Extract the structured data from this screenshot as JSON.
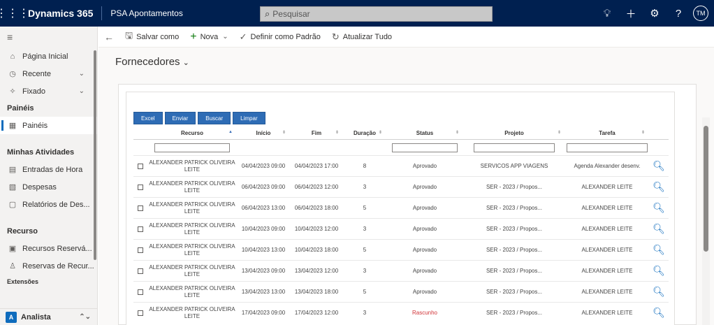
{
  "topbar": {
    "brand": "Dynamics 365",
    "app_name": "PSA Apontamentos",
    "search_placeholder": "Pesquisar",
    "avatar_initials": "TM",
    "icons": [
      "lightbulb-icon",
      "plus-icon",
      "settings-icon",
      "help-icon"
    ]
  },
  "sidebar": {
    "items": [
      {
        "label": "Página Inicial",
        "icon": "home-icon"
      },
      {
        "label": "Recente",
        "icon": "clock-icon"
      },
      {
        "label": "Fixado",
        "icon": "pin-icon"
      }
    ],
    "section_paineis": "Painéis",
    "paineis_item": "Painéis",
    "section_atividades": "Minhas Atividades",
    "atividades": [
      "Entradas de Hora",
      "Despesas",
      "Relatórios de Des..."
    ],
    "section_recurso": "Recurso",
    "recurso": [
      "Recursos Reservá...",
      "Reservas de Recur..."
    ],
    "section_extensoes": "Extensões",
    "area_badge": "A",
    "area_name": "Analista"
  },
  "commandbar": {
    "salvar_como": "Salvar como",
    "nova": "Nova",
    "definir_padrao": "Definir como Padrão",
    "atualizar_tudo": "Atualizar Tudo"
  },
  "page": {
    "title": "Fornecedores"
  },
  "actions": {
    "excel": "Excel",
    "enviar": "Enviar",
    "buscar": "Buscar",
    "limpar": "Limpar"
  },
  "grid": {
    "headers": {
      "recurso": "Recurso",
      "inicio": "Início",
      "fim": "Fim",
      "duracao": "Duração",
      "status": "Status",
      "projeto": "Projeto",
      "tarefa": "Tarefa"
    },
    "rows": [
      {
        "recurso_1": "ALEXANDER PATRICK OLIVEIRA",
        "recurso_2": "LEITE",
        "inicio": "04/04/2023 09:00",
        "fim": "04/04/2023 17:00",
        "duracao": "8",
        "status": "Aprovado",
        "projeto": "SERVICOS APP VIAGENS",
        "tarefa": "Agenda Alexander desenv."
      },
      {
        "recurso_1": "ALEXANDER PATRICK OLIVEIRA",
        "recurso_2": "LEITE",
        "inicio": "06/04/2023 09:00",
        "fim": "06/04/2023 12:00",
        "duracao": "3",
        "status": "Aprovado",
        "projeto": "SER - 2023 / Propos...",
        "tarefa": "ALEXANDER LEITE"
      },
      {
        "recurso_1": "ALEXANDER PATRICK OLIVEIRA",
        "recurso_2": "LEITE",
        "inicio": "06/04/2023 13:00",
        "fim": "06/04/2023 18:00",
        "duracao": "5",
        "status": "Aprovado",
        "projeto": "SER - 2023 / Propos...",
        "tarefa": "ALEXANDER LEITE"
      },
      {
        "recurso_1": "ALEXANDER PATRICK OLIVEIRA",
        "recurso_2": "LEITE",
        "inicio": "10/04/2023 09:00",
        "fim": "10/04/2023 12:00",
        "duracao": "3",
        "status": "Aprovado",
        "projeto": "SER - 2023 / Propos...",
        "tarefa": "ALEXANDER LEITE"
      },
      {
        "recurso_1": "ALEXANDER PATRICK OLIVEIRA",
        "recurso_2": "LEITE",
        "inicio": "10/04/2023 13:00",
        "fim": "10/04/2023 18:00",
        "duracao": "5",
        "status": "Aprovado",
        "projeto": "SER - 2023 / Propos...",
        "tarefa": "ALEXANDER LEITE"
      },
      {
        "recurso_1": "ALEXANDER PATRICK OLIVEIRA",
        "recurso_2": "LEITE",
        "inicio": "13/04/2023 09:00",
        "fim": "13/04/2023 12:00",
        "duracao": "3",
        "status": "Aprovado",
        "projeto": "SER - 2023 / Propos...",
        "tarefa": "ALEXANDER LEITE"
      },
      {
        "recurso_1": "ALEXANDER PATRICK OLIVEIRA",
        "recurso_2": "LEITE",
        "inicio": "13/04/2023 13:00",
        "fim": "13/04/2023 18:00",
        "duracao": "5",
        "status": "Aprovado",
        "projeto": "SER - 2023 / Propos...",
        "tarefa": "ALEXANDER LEITE"
      },
      {
        "recurso_1": "ALEXANDER PATRICK OLIVEIRA",
        "recurso_2": "LEITE",
        "inicio": "17/04/2023 09:00",
        "fim": "17/04/2023 12:00",
        "duracao": "3",
        "status": "Rascunho",
        "projeto": "SER - 2023 / Propos...",
        "tarefa": "ALEXANDER LEITE"
      }
    ]
  },
  "colors": {
    "topbar": "#002050",
    "accent": "#0f6cbd",
    "button": "#2e6cb5",
    "draft": "#d13438"
  }
}
